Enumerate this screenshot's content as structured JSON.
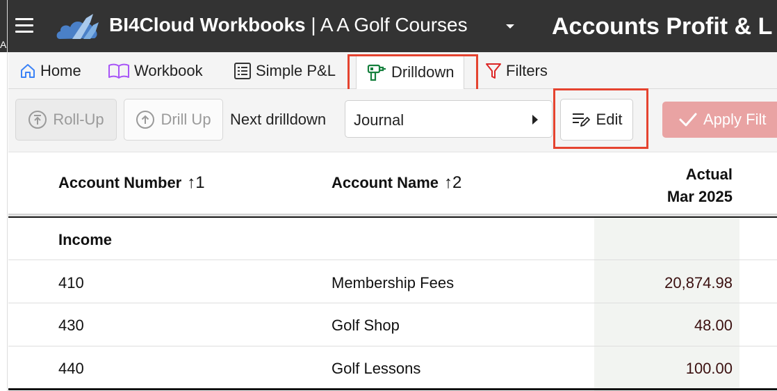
{
  "colors": {
    "header_bg": "#333333",
    "accent_highlight": "#e5432f",
    "apply_button": "#e9a3a3",
    "home_icon": "#3b82f6",
    "workbook_icon": "#a855f7",
    "drilldown_icon": "#15803d",
    "filters_icon": "#dc2626",
    "amount_text": "#3b1010"
  },
  "header": {
    "app_name": "BI4Cloud Workbooks",
    "separator": " | ",
    "company": "A A Golf Courses",
    "report_title": "Accounts Profit & L",
    "left_edge_char": "A"
  },
  "tabs": [
    {
      "label": "Home",
      "icon": "home-icon"
    },
    {
      "label": "Workbook",
      "icon": "book-icon"
    },
    {
      "label": "Simple P&L",
      "icon": "list-icon"
    },
    {
      "label": "Drilldown",
      "icon": "drill-icon",
      "active": true
    },
    {
      "label": "Filters",
      "icon": "filter-icon"
    }
  ],
  "toolbar": {
    "rollup_label": "Roll-Up",
    "drillup_label": "Drill Up",
    "next_drilldown_label": "Next drilldown",
    "next_drilldown_value": "Journal",
    "edit_label": "Edit",
    "apply_label": "Apply Filt"
  },
  "table": {
    "columns": {
      "account_number": "Account Number",
      "account_number_sort": "1",
      "account_name": "Account Name",
      "account_name_sort": "2",
      "actual_line1": "Actual",
      "actual_line2": "Mar 2025"
    },
    "section_label": "Income",
    "rows": [
      {
        "number": "410",
        "name": "Membership Fees",
        "actual": "20,874.98"
      },
      {
        "number": "430",
        "name": "Golf Shop",
        "actual": "48.00"
      },
      {
        "number": "440",
        "name": "Golf Lessons",
        "actual": "100.00"
      }
    ]
  }
}
